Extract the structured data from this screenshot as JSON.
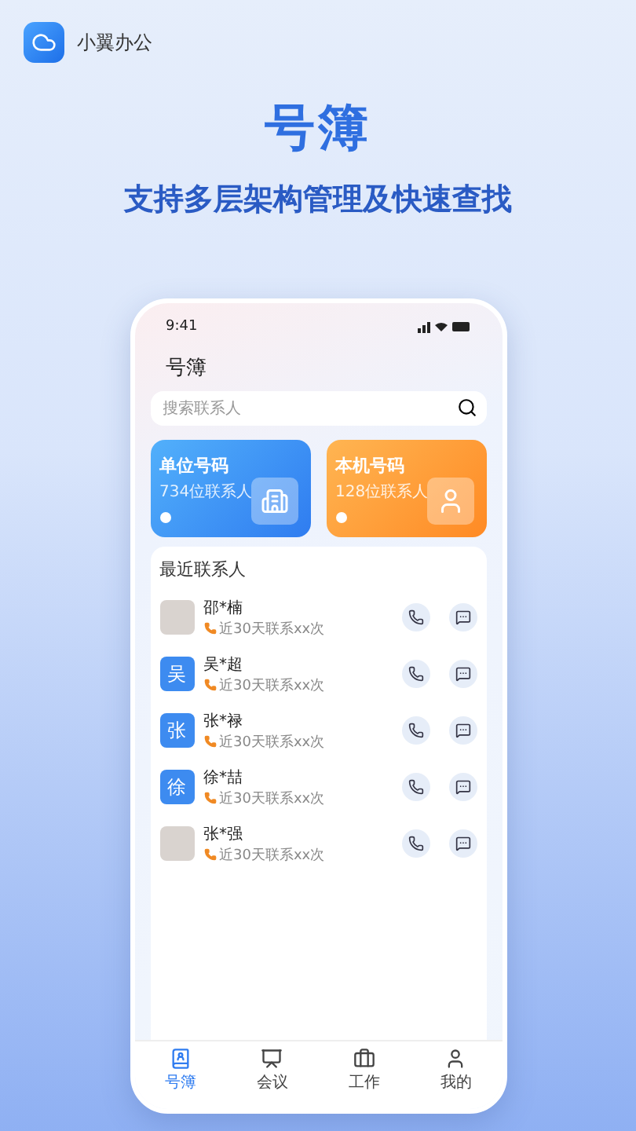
{
  "app": {
    "name": "小翼办公"
  },
  "headline": {
    "title": "号簿",
    "subtitle": "支持多层架构管理及快速查找"
  },
  "phone": {
    "status_time": "9:41",
    "page_title": "号簿",
    "search": {
      "placeholder": "搜索联系人"
    },
    "cards": [
      {
        "kind": "unit",
        "title": "单位号码",
        "count": "734位联系人"
      },
      {
        "kind": "local",
        "title": "本机号码",
        "count": "128位联系人"
      }
    ],
    "recent": {
      "title": "最近联系人",
      "contacts": [
        {
          "name": "邵*楠",
          "note": "近30天联系xx次",
          "avatar": {
            "kind": "photo"
          }
        },
        {
          "name": "吴*超",
          "note": "近30天联系xx次",
          "avatar": {
            "kind": "letter",
            "text": "吴"
          }
        },
        {
          "name": "张*禄",
          "note": "近30天联系xx次",
          "avatar": {
            "kind": "letter",
            "text": "张"
          }
        },
        {
          "name": "徐*喆",
          "note": "近30天联系xx次",
          "avatar": {
            "kind": "letter",
            "text": "徐"
          }
        },
        {
          "name": "张*强",
          "note": "近30天联系xx次",
          "avatar": {
            "kind": "photo"
          }
        }
      ]
    },
    "tabs": [
      {
        "kind": "book",
        "label": "号簿",
        "selected": true
      },
      {
        "kind": "meeting",
        "label": "会议",
        "selected": false
      },
      {
        "kind": "work",
        "label": "工作",
        "selected": false
      },
      {
        "kind": "me",
        "label": "我的",
        "selected": false
      }
    ]
  }
}
